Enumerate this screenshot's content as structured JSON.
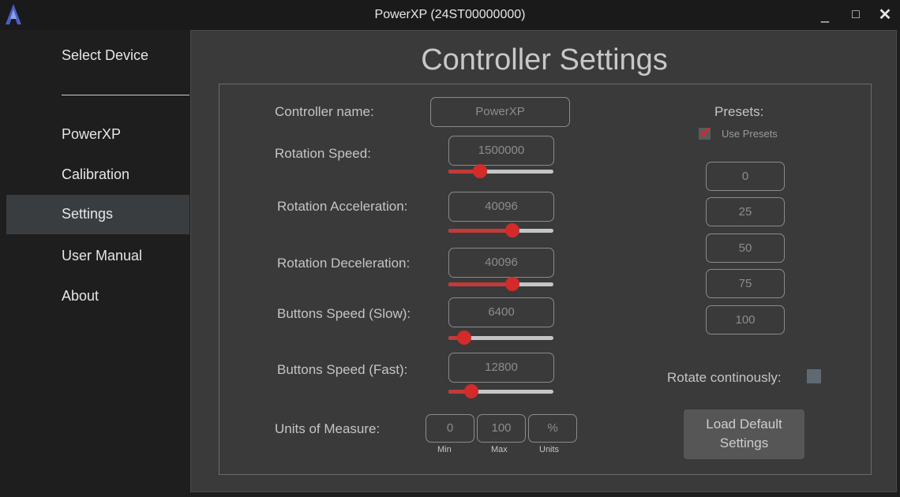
{
  "window": {
    "title": "PowerXP (24ST00000000)",
    "minimize": "_",
    "maximize": "□",
    "close": "✕"
  },
  "sidebar": {
    "items": [
      {
        "label": "Select Device"
      },
      {
        "label": "PowerXP"
      },
      {
        "label": "Calibration"
      },
      {
        "label": "Settings",
        "active": true
      },
      {
        "label": "User Manual"
      },
      {
        "label": "About"
      }
    ]
  },
  "page": {
    "title": "Controller Settings"
  },
  "settings": {
    "controller_name": {
      "label": "Controller name:",
      "value": "PowerXP"
    },
    "rotation_speed": {
      "label": "Rotation Speed:",
      "value": "1500000",
      "slider_fraction": 0.3
    },
    "rotation_acceleration": {
      "label": "Rotation Acceleration:",
      "value": "40096",
      "slider_fraction": 0.61
    },
    "rotation_deceleration": {
      "label": "Rotation Deceleration:",
      "value": "40096",
      "slider_fraction": 0.61
    },
    "buttons_speed_slow": {
      "label": "Buttons Speed (Slow):",
      "value": "6400",
      "slider_fraction": 0.15
    },
    "buttons_speed_fast": {
      "label": "Buttons Speed (Fast):",
      "value": "12800",
      "slider_fraction": 0.22
    },
    "units_of_measure": {
      "label": "Units of Measure:",
      "min": "0",
      "max": "100",
      "units": "%",
      "min_label": "Min",
      "max_label": "Max",
      "units_label": "Units"
    }
  },
  "presets": {
    "title": "Presets:",
    "use_presets_label": "Use Presets",
    "use_presets_checked": true,
    "values": [
      "0",
      "25",
      "50",
      "75",
      "100"
    ]
  },
  "rotate_continuously": {
    "label": "Rotate continously:",
    "checked": false
  },
  "load_defaults": {
    "line1": "Load Default",
    "line2": "Settings"
  },
  "colors": {
    "accent": "#d42a2a",
    "panel_bg": "#3a3a3a",
    "sidebar_active": "#393d40"
  }
}
